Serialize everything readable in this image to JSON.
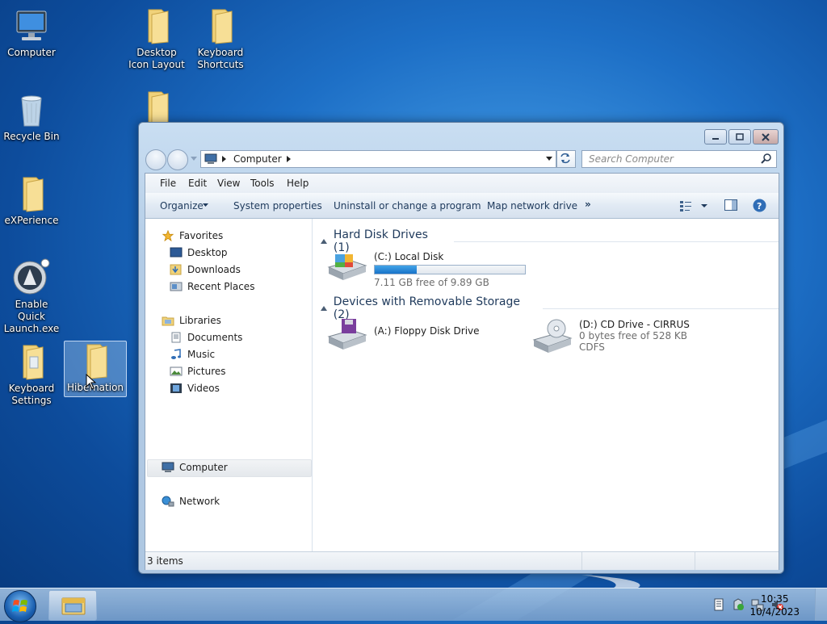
{
  "desktop": {
    "icons": [
      {
        "label": "Computer",
        "icon": "computer-icon"
      },
      {
        "label": "Recycle Bin",
        "icon": "recycle-bin-icon"
      },
      {
        "label": "eXPerience",
        "icon": "folder-icon"
      },
      {
        "label": "Enable Quick Launch.exe",
        "icon": "app-icon"
      },
      {
        "label": "Keyboard Settings",
        "icon": "folder-icon"
      },
      {
        "label": "Desktop Icon Layout",
        "icon": "folder-icon"
      },
      {
        "label": "Keyboard Shortcuts",
        "icon": "folder-icon"
      },
      {
        "label": "Hibernation",
        "icon": "folder-icon"
      }
    ]
  },
  "window": {
    "address": {
      "location": "Computer"
    },
    "search": {
      "placeholder": "Search Computer"
    },
    "menu": [
      "File",
      "Edit",
      "View",
      "Tools",
      "Help"
    ],
    "toolbar": {
      "organize": "Organize",
      "system_properties": "System properties",
      "uninstall": "Uninstall or change a program",
      "map_drive": "Map network drive",
      "more": "»"
    },
    "nav": {
      "favorites": "Favorites",
      "favorites_items": [
        "Desktop",
        "Downloads",
        "Recent Places"
      ],
      "libraries": "Libraries",
      "libraries_items": [
        "Documents",
        "Music",
        "Pictures",
        "Videos"
      ],
      "computer": "Computer",
      "network": "Network"
    },
    "groups": {
      "hdd": "Hard Disk Drives (1)",
      "removable": "Devices with Removable Storage (2)"
    },
    "drives": {
      "c": {
        "name": "(C:) Local Disk",
        "free": "7.11 GB free of 9.89 GB",
        "used_fraction": 0.28
      },
      "a": {
        "name": "(A:) Floppy Disk Drive"
      },
      "d": {
        "name": "(D:) CD Drive - CIRRUS",
        "free": "0 bytes free of 528 KB",
        "fs": "CDFS"
      }
    },
    "status": "3 items"
  },
  "taskbar": {
    "time": "10:35",
    "date": "10/4/2023"
  },
  "colors": {
    "accent": "#1d6fc6",
    "progress": "#2a8ad8"
  }
}
